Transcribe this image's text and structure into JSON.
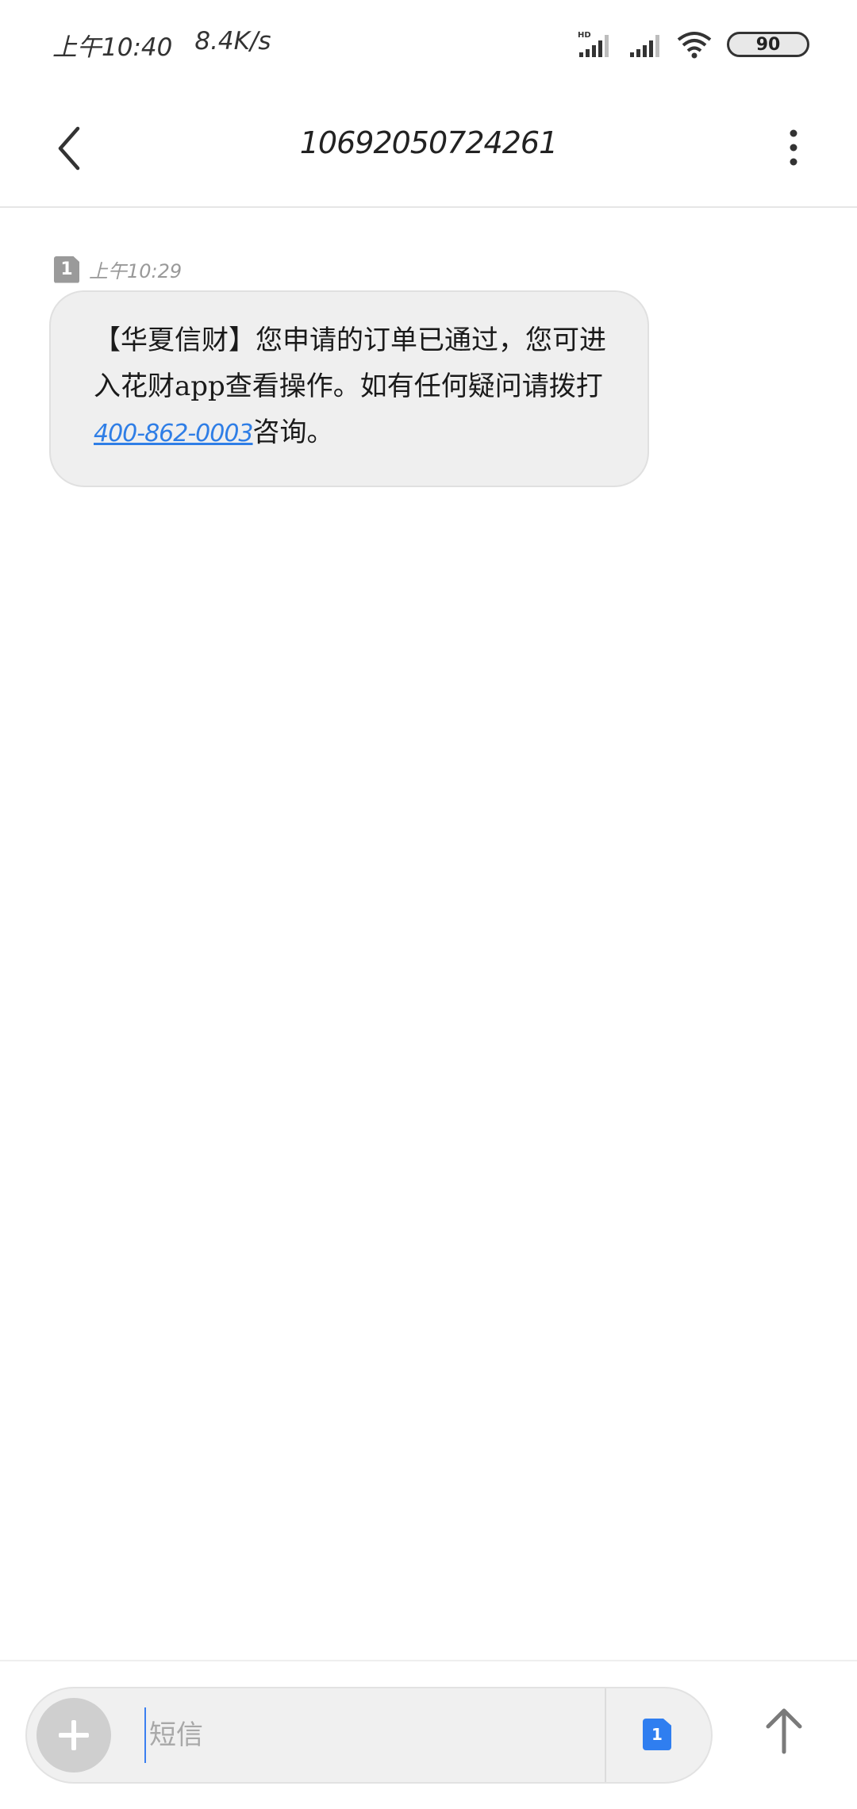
{
  "status_bar": {
    "time": "上午10:40",
    "speed": "8.4K/s",
    "hd_label": "HD",
    "battery": "90"
  },
  "header": {
    "title": "10692050724261",
    "back_icon": "chevron-left-icon",
    "more_icon": "more-vertical-icon"
  },
  "message": {
    "sim": "1",
    "time": "上午10:29",
    "text_before_link": "【华夏信财】您申请的订单已通过，您可进入花财app查看操作。如有任何疑问请拨打",
    "link": "400-862-0003",
    "text_after_link": "咨询。"
  },
  "composer": {
    "placeholder": "短信",
    "sim": "1",
    "add_icon": "plus-icon",
    "send_icon": "arrow-up-icon"
  },
  "colors": {
    "link": "#2f7ee6",
    "sim_active": "#2f7ef0",
    "bubble": "#efefef"
  }
}
